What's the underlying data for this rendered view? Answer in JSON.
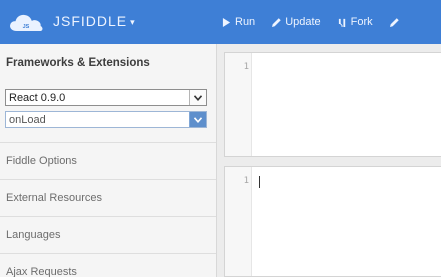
{
  "header": {
    "brand": "JSFIDDLE",
    "brand_caret": "▾",
    "actions": [
      {
        "label": "Run",
        "icon": "play-icon"
      },
      {
        "label": "Update",
        "icon": "pencil-icon"
      },
      {
        "label": "Fork",
        "icon": "fork-icon"
      }
    ]
  },
  "sidebar": {
    "panel_title": "Frameworks & Extensions",
    "framework_select": {
      "value": "React 0.9.0"
    },
    "load_select": {
      "value": "onLoad"
    },
    "sections": [
      {
        "label": "Fiddle Options"
      },
      {
        "label": "External Resources"
      },
      {
        "label": "Languages"
      },
      {
        "label": "Ajax Requests"
      }
    ]
  },
  "editors": {
    "top": {
      "line_number": "1"
    },
    "bottom": {
      "line_number": "1"
    }
  },
  "colors": {
    "header_bg": "#3e7fd6",
    "sidebar_bg": "#f5f5f5",
    "select_accent": "#5e8fcc"
  }
}
